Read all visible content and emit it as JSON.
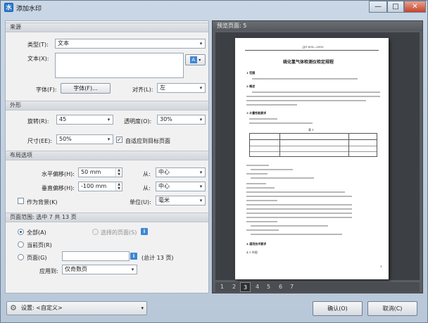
{
  "window": {
    "title": "添加水印",
    "app_icon": "水",
    "controls": {
      "minimize": "—",
      "maximize": "□",
      "close": "✕"
    }
  },
  "source": {
    "header": "来源",
    "type_label": "类型(T):",
    "type_value": "文本",
    "text_label": "文本(X):",
    "text_value": "",
    "font_label": "字体(F):",
    "font_button": "字体(F)...",
    "align_label": "对齐(L):",
    "align_value": "左",
    "insert_icon": "A"
  },
  "appearance": {
    "header": "外形",
    "rotation_label": "旋转(R):",
    "rotation_value": "45",
    "opacity_label": "透明度(O):",
    "opacity_value": "30%",
    "size_label": "尺寸(EE):",
    "size_value": "50%",
    "fit_label": "自适应到目标页面",
    "fit_checked": "✓"
  },
  "layout": {
    "header": "布局选项",
    "h_offset_label": "水平偏移(H):",
    "h_offset_value": "50 mm",
    "h_from_label": "从:",
    "h_from_value": "中心",
    "v_offset_label": "垂直偏移(H):",
    "v_offset_value": "-100 mm",
    "v_from_label": "从:",
    "v_from_value": "中心",
    "background_label": "作为背景(K)",
    "unit_label": "单位(U):",
    "unit_value": "毫米"
  },
  "page_range": {
    "header": "页面范围: 选中 7 共 13 页",
    "all_label": "全部(A)",
    "selected_label": "选择的页面(S)",
    "current_label": "当前页(R)",
    "pages_label": "页面(G)",
    "pages_value": "",
    "total_label": "(总计 13 页)",
    "apply_label": "应用到:",
    "apply_value": "仅奇数页",
    "info_icon": "i"
  },
  "preview": {
    "header": "预览页面: 5",
    "tabs": [
      "1",
      "2",
      "3",
      "4",
      "5",
      "6",
      "7"
    ],
    "active_tab": "3",
    "doc": {
      "top_code": "JJG 693—2003",
      "title": "硫化氢气体检测仪检定规程",
      "h1": "1  范围",
      "h2": "2  概述",
      "h3": "3  计量性能要求",
      "table_title": "表 1",
      "h4": "4  通用技术要求",
      "h4_1": "4.1  外观",
      "page_num": "1"
    }
  },
  "bottom": {
    "settings_label": "设置: <自定义>",
    "ok_label": "确认(O)",
    "cancel_label": "取消(C)"
  },
  "colors": {
    "accent": "#1d5fae",
    "preview_bg": "#3c3f43"
  }
}
